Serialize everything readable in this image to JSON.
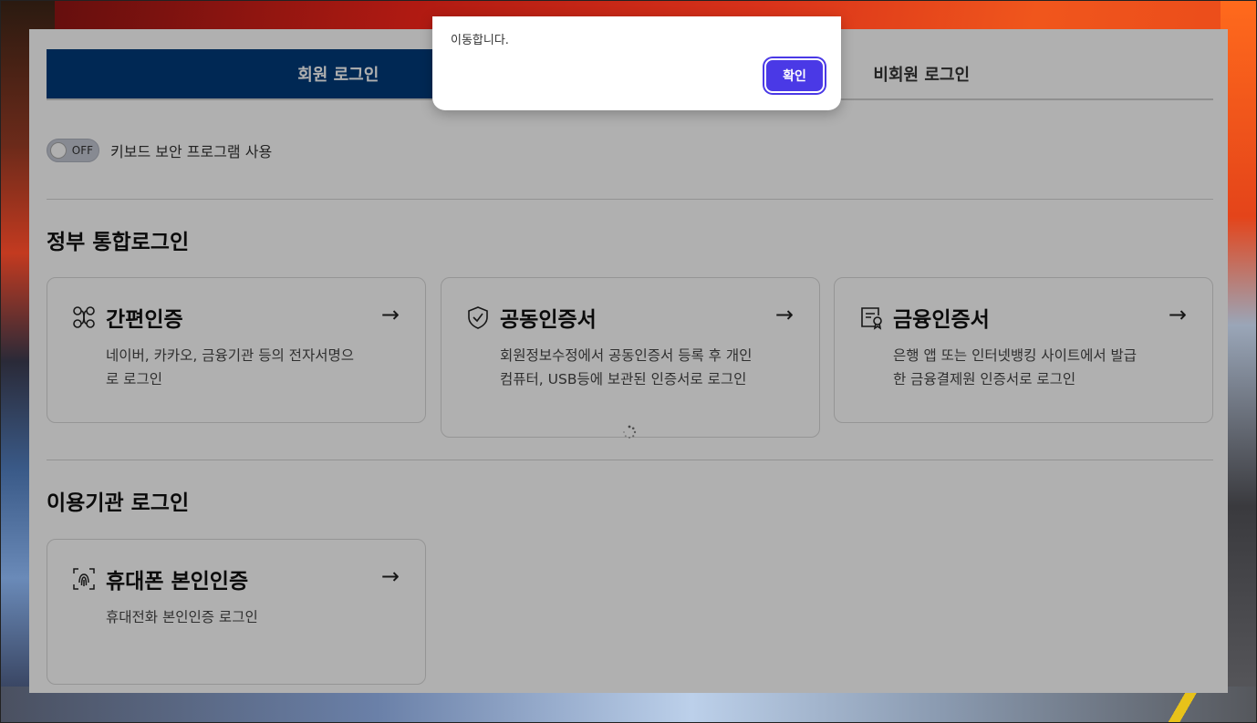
{
  "tabs": [
    {
      "label": "회원 로그인",
      "active": true
    },
    {
      "label": "비회원 로그인",
      "active": false
    }
  ],
  "keyboard_security": {
    "toggle_state": "OFF",
    "label": "키보드 보안 프로그램 사용"
  },
  "gov_section": {
    "title": "정부 통합로그인",
    "cards": [
      {
        "title": "간편인증",
        "desc": "네이버, 카카오, 금융기관 등의 전자서명으로 로그인",
        "icon": "flow-icon"
      },
      {
        "title": "공동인증서",
        "desc": "회원정보수정에서 공동인증서 등록 후 개인 컴퓨터, USB등에 보관된 인증서로 로그인",
        "icon": "shield-check-icon"
      },
      {
        "title": "금융인증서",
        "desc": "은행 앱 또는 인터넷뱅킹 사이트에서 발급한 금융결제원 인증서로 로그인",
        "icon": "certificate-icon"
      }
    ]
  },
  "org_section": {
    "title": "이용기관 로그인",
    "cards": [
      {
        "title": "휴대폰 본인인증",
        "desc": "휴대전화 본인인증 로그인",
        "icon": "fingerprint-icon"
      }
    ]
  },
  "arrow": "→",
  "dialog": {
    "message": "이동합니다.",
    "ok_label": "확인"
  },
  "colors": {
    "active_tab": "#003a7a",
    "dialog_button": "#4a39e6"
  }
}
